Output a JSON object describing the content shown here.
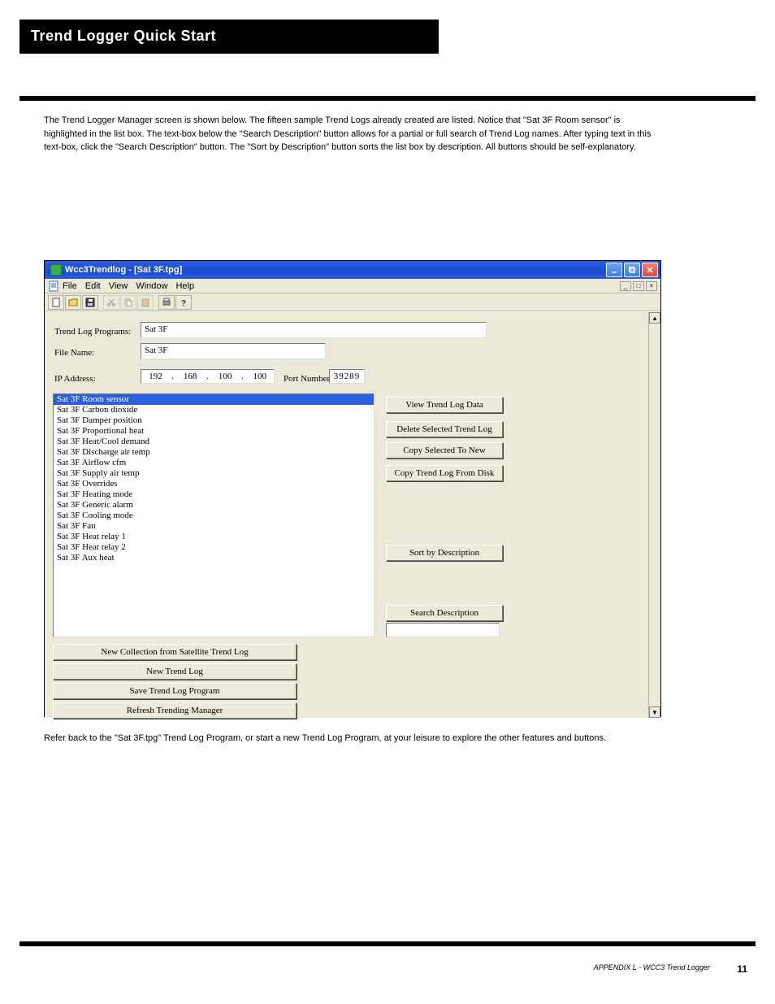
{
  "page": {
    "header": "Trend Logger Quick Start",
    "number": "11",
    "doc_title": "APPENDIX L - WCC3 Trend Logger"
  },
  "intro": "The Trend Logger Manager screen is shown below. The fifteen sample Trend Logs already created are listed. Notice that \"Sat 3F Room sensor\" is highlighted in the list box. The text-box below the \"Search Description\" button allows for a partial or full search of Trend Log names. After typing text in this text-box, click the \"Search Description\" button. The \"Sort by Description\" button sorts the list box by description. All buttons should be self-explanatory.",
  "caption": "Refer back to the \"Sat 3F.tpg\" Trend Log Program, or start a new Trend Log Program, at your leisure to explore the other features and buttons.",
  "window": {
    "title": "Wcc3Trendlog - [Sat 3F.tpg]",
    "menus": [
      "File",
      "Edit",
      "View",
      "Window",
      "Help"
    ],
    "labels": {
      "programs": "Trend Log Programs:",
      "filename": "File Name:",
      "ip": "IP Address:",
      "port": "Port Number:"
    },
    "values": {
      "programs": "Sat 3F",
      "filename": "Sat 3F",
      "ip": [
        "192",
        "168",
        "100",
        "100"
      ],
      "port": "39289"
    },
    "list": [
      "Sat 3F Room sensor",
      "Sat 3F Carbon dioxide",
      "Sat 3F Damper position",
      "Sat 3F Proportional heat",
      "Sat 3F Heat/Cool demand",
      "Sat 3F Discharge air temp",
      "Sat 3F Airflow cfm",
      "Sat 3F Supply air temp",
      "Sat 3F Overrides",
      "Sat 3F Heating mode",
      "Sat 3F Generic alarm",
      "Sat 3F Cooling mode",
      "Sat 3F Fan",
      "Sat 3F Heat relay 1",
      "Sat 3F Heat relay 2",
      "Sat 3F Aux heat"
    ],
    "buttons": {
      "view": "View Trend Log Data",
      "delete": "Delete Selected Trend Log",
      "copy_new": "Copy Selected To New",
      "copy_disk": "Copy Trend Log From Disk",
      "sort": "Sort by Description",
      "search": "Search Description",
      "search_value": "",
      "new_coll": "New Collection from Satellite Trend Log",
      "new_log": "New Trend Log",
      "save_prog": "Save Trend Log Program",
      "refresh": "Refresh Trending Manager"
    }
  }
}
